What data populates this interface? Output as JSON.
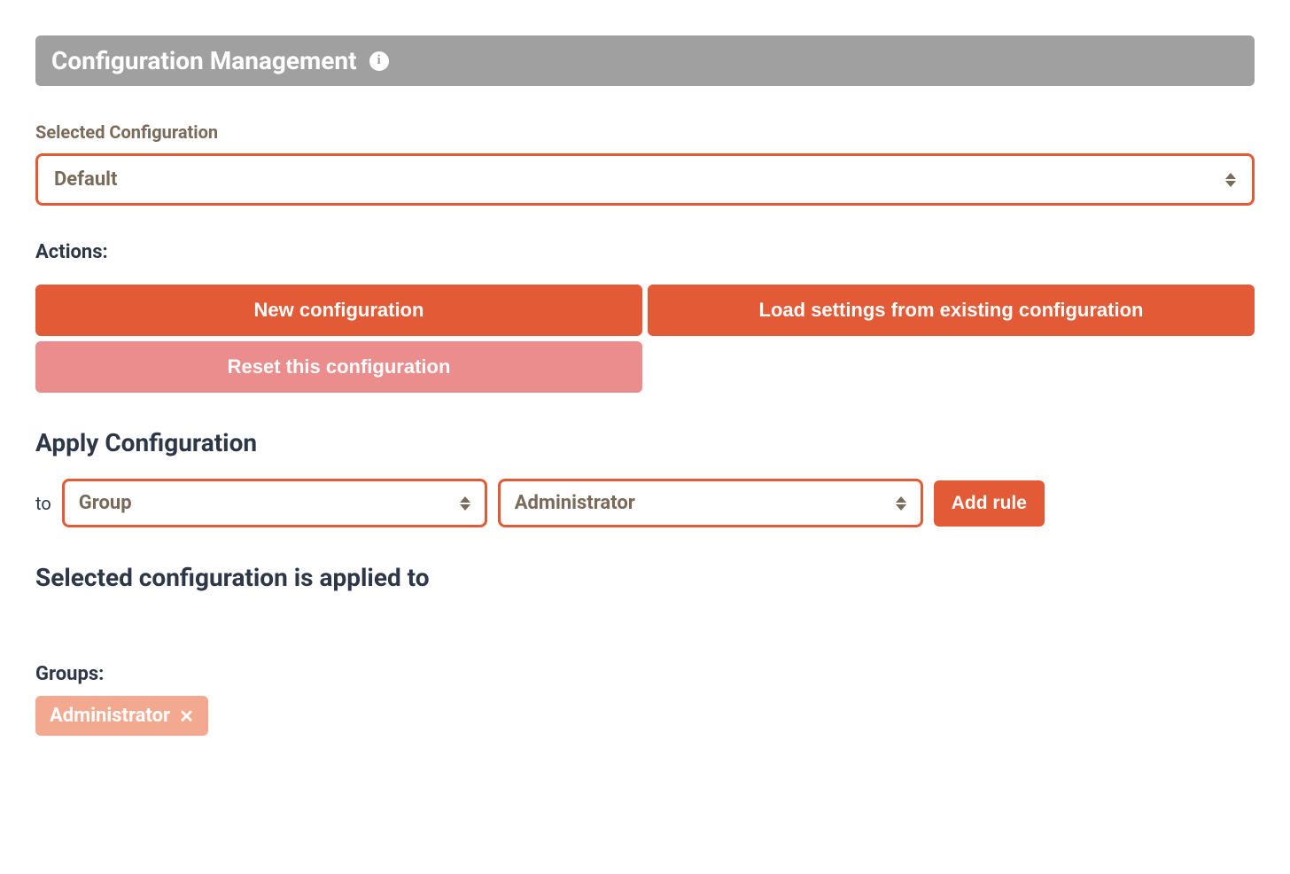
{
  "header": {
    "title": "Configuration Management"
  },
  "selectedConfig": {
    "label": "Selected Configuration",
    "value": "Default"
  },
  "actions": {
    "label": "Actions:",
    "newConfig": "New configuration",
    "loadSettings": "Load settings from existing configuration",
    "reset": "Reset this configuration"
  },
  "applyConfig": {
    "heading": "Apply Configuration",
    "toLabel": "to",
    "targetType": "Group",
    "targetValue": "Administrator",
    "addRule": "Add rule"
  },
  "appliedTo": {
    "heading": "Selected configuration is applied to",
    "groupsLabel": "Groups:",
    "groups": [
      "Administrator"
    ]
  }
}
